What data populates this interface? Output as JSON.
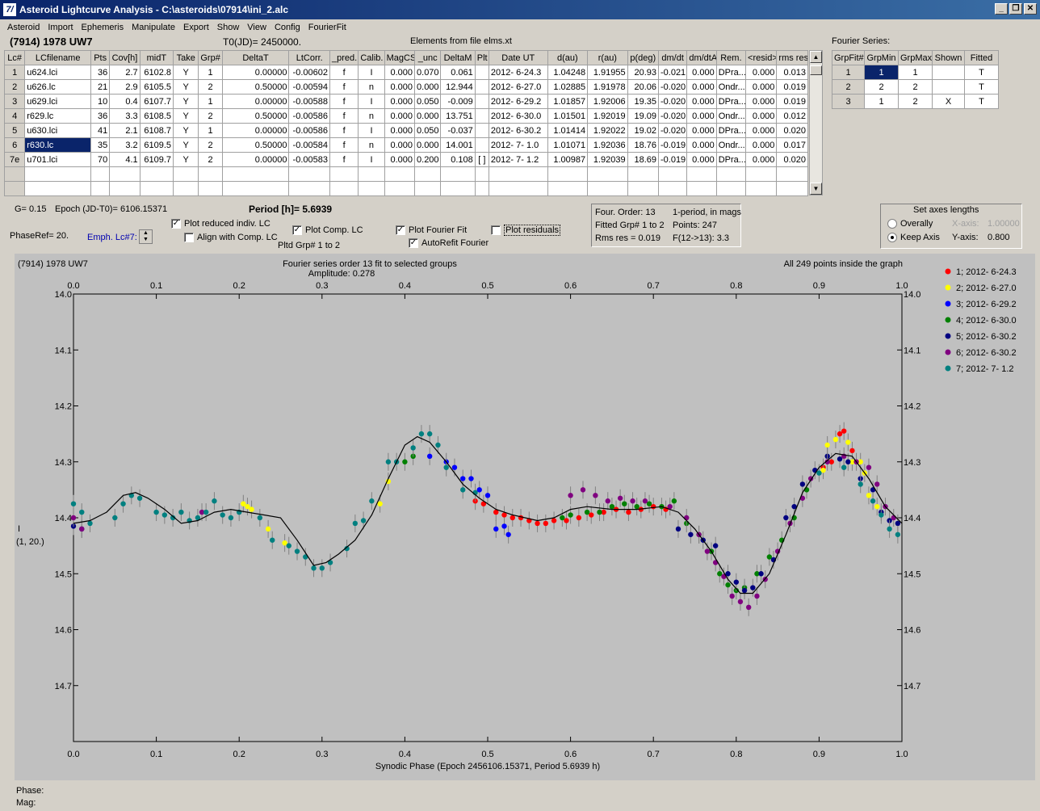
{
  "window": {
    "title": "Asteroid Lightcurve Analysis - C:\\asteroids\\07914\\ini_2.alc",
    "logo": "7/"
  },
  "menu": [
    "Asteroid",
    "Import",
    "Ephemeris",
    "Manipulate",
    "Export",
    "Show",
    "View",
    "Config",
    "FourierFit"
  ],
  "header": {
    "object": "(7914) 1978 UW7",
    "t0": "T0(JD)= 2450000.",
    "elements": "Elements from file elms.xt"
  },
  "lc_table": {
    "columns": [
      "Lc#",
      "LCfilename",
      "Pts",
      "Cov[h]",
      "midT",
      "Take",
      "Grp#",
      "DeltaT",
      "LtCorr.",
      "_pred.",
      "Calib.",
      "MagCS",
      "_unc",
      "DeltaM",
      "Plt",
      "Date UT",
      "d(au)",
      "r(au)",
      "p(deg)",
      "dm/dt",
      "dm/dtA",
      "Rem.",
      "<resid>",
      "rms res"
    ],
    "rows": [
      [
        "1",
        "u624.lci",
        "36",
        "2.7",
        "6102.8",
        "Y",
        "1",
        "0.00000",
        "-0.00602",
        "f",
        "I",
        "0.000",
        "0.070",
        "0.061",
        "",
        "2012- 6-24.3",
        "1.04248",
        "1.91955",
        "20.93",
        "-0.021",
        "0.000",
        "DPra...",
        "0.000",
        "0.013"
      ],
      [
        "2",
        "u626.lc",
        "21",
        "2.9",
        "6105.5",
        "Y",
        "2",
        "0.50000",
        "-0.00594",
        "f",
        "n",
        "0.000",
        "0.000",
        "12.944",
        "",
        "2012- 6-27.0",
        "1.02885",
        "1.91978",
        "20.06",
        "-0.020",
        "0.000",
        "Ondr...",
        "0.000",
        "0.019"
      ],
      [
        "3",
        "u629.lci",
        "10",
        "0.4",
        "6107.7",
        "Y",
        "1",
        "0.00000",
        "-0.00588",
        "f",
        "I",
        "0.000",
        "0.050",
        "-0.009",
        "",
        "2012- 6-29.2",
        "1.01857",
        "1.92006",
        "19.35",
        "-0.020",
        "0.000",
        "DPra...",
        "0.000",
        "0.019"
      ],
      [
        "4",
        "r629.lc",
        "36",
        "3.3",
        "6108.5",
        "Y",
        "2",
        "0.50000",
        "-0.00586",
        "f",
        "n",
        "0.000",
        "0.000",
        "13.751",
        "",
        "2012- 6-30.0",
        "1.01501",
        "1.92019",
        "19.09",
        "-0.020",
        "0.000",
        "Ondr...",
        "0.000",
        "0.012"
      ],
      [
        "5",
        "u630.lci",
        "41",
        "2.1",
        "6108.7",
        "Y",
        "1",
        "0.00000",
        "-0.00586",
        "f",
        "I",
        "0.000",
        "0.050",
        "-0.037",
        "",
        "2012- 6-30.2",
        "1.01414",
        "1.92022",
        "19.02",
        "-0.020",
        "0.000",
        "DPra...",
        "0.000",
        "0.020"
      ],
      [
        "6",
        "r630.lc",
        "35",
        "3.2",
        "6109.5",
        "Y",
        "2",
        "0.50000",
        "-0.00584",
        "f",
        "n",
        "0.000",
        "0.000",
        "14.001",
        "",
        "2012- 7- 1.0",
        "1.01071",
        "1.92036",
        "18.76",
        "-0.019",
        "0.000",
        "Ondr...",
        "0.000",
        "0.017"
      ],
      [
        "7e",
        "u701.lci",
        "70",
        "4.1",
        "6109.7",
        "Y",
        "2",
        "0.00000",
        "-0.00583",
        "f",
        "I",
        "0.000",
        "0.200",
        "0.108",
        "[ ]",
        "2012- 7- 1.2",
        "1.00987",
        "1.92039",
        "18.69",
        "-0.019",
        "0.000",
        "DPra...",
        "0.000",
        "0.020"
      ]
    ]
  },
  "fourier_series": {
    "title": "Fourier Series:",
    "columns": [
      "GrpFit#",
      "GrpMin",
      "GrpMax",
      "Shown",
      "Fitted"
    ],
    "rows": [
      [
        "1",
        "1",
        "1",
        "",
        "T"
      ],
      [
        "2",
        "2",
        "2",
        "",
        "T"
      ],
      [
        "3",
        "1",
        "2",
        "X",
        "T"
      ]
    ]
  },
  "controls": {
    "g": "G= 0.15",
    "epoch": "Epoch (JD-T0)= 6106.15371",
    "period": "Period [h]= 5.6939",
    "phaseref": "PhaseRef= 20.",
    "emph": "Emph. Lc#7:",
    "plot_reduced": "Plot reduced indiv. LC",
    "align": "Align with Comp. LC",
    "plot_comp": "Plot Comp. LC",
    "pltd_grp": "Pltd Grp#  1   to   2",
    "plot_fourier": "Plot Fourier Fit",
    "autorefit": "AutoRefit Fourier",
    "plot_resid": "Plot residuals"
  },
  "fitinfo": {
    "l1a": "Four. Order: 13",
    "l1b": "1-period, in mags",
    "l2a": "Fitted Grp# 1 to 2",
    "l2b": "Points: 247",
    "l3a": "Rms res     = 0.019",
    "l3b": "F(12->13):  3.3"
  },
  "axes_box": {
    "title": "Set axes lengths",
    "overally": "Overally",
    "keep": "Keep Axis",
    "xlab": "X-axis:",
    "xval": "1.00000",
    "ylab": "Y-axis:",
    "yval": "0.800"
  },
  "plot": {
    "top_left": "(7914) 1978 UW7",
    "title1": "Fourier series order 13 fit to selected groups",
    "title2": "Amplitude: 0.278",
    "top_right": "All 249 points inside the graph",
    "ylabel1": "I",
    "ylabel2": "(1, 20.)",
    "xlabel": "Synodic Phase (Epoch 2456106.15371, Period 5.6939 h)"
  },
  "status": {
    "phase": "Phase:",
    "mag": "Mag:"
  },
  "chart_data": {
    "type": "scatter",
    "x_ticks": [
      "0.0",
      "0.1",
      "0.2",
      "0.3",
      "0.4",
      "0.5",
      "0.6",
      "0.7",
      "0.8",
      "0.9",
      "1.0"
    ],
    "y_ticks": [
      "14.0",
      "14.1",
      "14.2",
      "14.3",
      "14.4",
      "14.5",
      "14.6",
      "14.7"
    ],
    "xlim": [
      0,
      1
    ],
    "ylim": [
      14.8,
      14.0
    ],
    "series": [
      {
        "name": "1; 2012- 6-24.3",
        "color": "#ff0000",
        "points": [
          [
            0.51,
            14.39
          ],
          [
            0.52,
            14.395
          ],
          [
            0.53,
            14.4
          ],
          [
            0.54,
            14.4
          ],
          [
            0.55,
            14.405
          ],
          [
            0.56,
            14.41
          ],
          [
            0.57,
            14.41
          ],
          [
            0.58,
            14.405
          ],
          [
            0.595,
            14.405
          ],
          [
            0.61,
            14.4
          ],
          [
            0.625,
            14.395
          ],
          [
            0.64,
            14.39
          ],
          [
            0.655,
            14.385
          ],
          [
            0.67,
            14.39
          ],
          [
            0.685,
            14.385
          ],
          [
            0.7,
            14.38
          ],
          [
            0.715,
            14.385
          ],
          [
            0.485,
            14.37
          ],
          [
            0.495,
            14.375
          ],
          [
            0.905,
            14.31
          ],
          [
            0.915,
            14.3
          ],
          [
            0.925,
            14.25
          ],
          [
            0.93,
            14.245
          ],
          [
            0.94,
            14.28
          ]
        ]
      },
      {
        "name": "2; 2012- 6-27.0",
        "color": "#ffff00",
        "points": [
          [
            0.205,
            14.375
          ],
          [
            0.21,
            14.38
          ],
          [
            0.215,
            14.385
          ],
          [
            0.235,
            14.42
          ],
          [
            0.255,
            14.445
          ],
          [
            0.38,
            14.335
          ],
          [
            0.37,
            14.375
          ],
          [
            0.905,
            14.315
          ],
          [
            0.91,
            14.27
          ],
          [
            0.92,
            14.26
          ],
          [
            0.935,
            14.265
          ],
          [
            0.955,
            14.32
          ],
          [
            0.96,
            14.36
          ],
          [
            0.95,
            14.3
          ],
          [
            0.97,
            14.38
          ],
          [
            0.94,
            14.3
          ]
        ]
      },
      {
        "name": "3; 2012- 6-29.2",
        "color": "#0000ff",
        "points": [
          [
            0.43,
            14.29
          ],
          [
            0.45,
            14.3
          ],
          [
            0.46,
            14.31
          ],
          [
            0.47,
            14.33
          ],
          [
            0.48,
            14.33
          ],
          [
            0.49,
            14.35
          ],
          [
            0.5,
            14.36
          ],
          [
            0.51,
            14.42
          ],
          [
            0.52,
            14.415
          ],
          [
            0.525,
            14.43
          ]
        ]
      },
      {
        "name": "4; 2012- 6-30.0",
        "color": "#008000",
        "points": [
          [
            0.4,
            14.3
          ],
          [
            0.41,
            14.29
          ],
          [
            0.59,
            14.4
          ],
          [
            0.6,
            14.395
          ],
          [
            0.62,
            14.39
          ],
          [
            0.635,
            14.39
          ],
          [
            0.65,
            14.38
          ],
          [
            0.665,
            14.375
          ],
          [
            0.68,
            14.38
          ],
          [
            0.695,
            14.375
          ],
          [
            0.71,
            14.38
          ],
          [
            0.725,
            14.37
          ],
          [
            0.74,
            14.41
          ],
          [
            0.755,
            14.43
          ],
          [
            0.77,
            14.46
          ],
          [
            0.78,
            14.5
          ],
          [
            0.79,
            14.52
          ],
          [
            0.8,
            14.53
          ],
          [
            0.81,
            14.525
          ],
          [
            0.825,
            14.5
          ],
          [
            0.84,
            14.47
          ],
          [
            0.855,
            14.44
          ],
          [
            0.87,
            14.4
          ],
          [
            0.885,
            14.35
          ]
        ]
      },
      {
        "name": "5; 2012- 6-30.2",
        "color": "#000080",
        "points": [
          [
            0.73,
            14.42
          ],
          [
            0.745,
            14.43
          ],
          [
            0.76,
            14.44
          ],
          [
            0.775,
            14.45
          ],
          [
            0.79,
            14.5
          ],
          [
            0.8,
            14.515
          ],
          [
            0.81,
            14.53
          ],
          [
            0.82,
            14.525
          ],
          [
            0.83,
            14.5
          ],
          [
            0.845,
            14.475
          ],
          [
            0.86,
            14.4
          ],
          [
            0.87,
            14.38
          ],
          [
            0.88,
            14.34
          ],
          [
            0.895,
            14.315
          ],
          [
            0.91,
            14.29
          ],
          [
            0.925,
            14.295
          ],
          [
            0.935,
            14.3
          ],
          [
            0.95,
            14.33
          ],
          [
            0.965,
            14.35
          ],
          [
            0.975,
            14.39
          ],
          [
            0.985,
            14.405
          ],
          [
            0.995,
            14.41
          ],
          [
            0.0,
            14.415
          ],
          [
            0.01,
            14.42
          ]
        ]
      },
      {
        "name": "6; 2012- 6-30.2",
        "color": "#800080",
        "points": [
          [
            0.0,
            14.4
          ],
          [
            0.01,
            14.42
          ],
          [
            0.155,
            14.39
          ],
          [
            0.6,
            14.36
          ],
          [
            0.615,
            14.35
          ],
          [
            0.63,
            14.36
          ],
          [
            0.645,
            14.37
          ],
          [
            0.66,
            14.365
          ],
          [
            0.675,
            14.37
          ],
          [
            0.69,
            14.37
          ],
          [
            0.72,
            14.38
          ],
          [
            0.74,
            14.4
          ],
          [
            0.755,
            14.43
          ],
          [
            0.765,
            14.46
          ],
          [
            0.775,
            14.48
          ],
          [
            0.785,
            14.505
          ],
          [
            0.795,
            14.54
          ],
          [
            0.805,
            14.55
          ],
          [
            0.815,
            14.56
          ],
          [
            0.825,
            14.54
          ],
          [
            0.835,
            14.51
          ],
          [
            0.85,
            14.46
          ],
          [
            0.865,
            14.41
          ],
          [
            0.88,
            14.365
          ],
          [
            0.89,
            14.33
          ],
          [
            0.91,
            14.3
          ],
          [
            0.93,
            14.29
          ],
          [
            0.945,
            14.3
          ],
          [
            0.96,
            14.31
          ],
          [
            0.97,
            14.34
          ],
          [
            0.98,
            14.38
          ],
          [
            0.99,
            14.4
          ]
        ]
      },
      {
        "name": "7; 2012- 7- 1.2",
        "color": "#008080",
        "points": [
          [
            0.0,
            14.375
          ],
          [
            0.01,
            14.39
          ],
          [
            0.02,
            14.41
          ],
          [
            0.05,
            14.4
          ],
          [
            0.06,
            14.375
          ],
          [
            0.07,
            14.36
          ],
          [
            0.08,
            14.365
          ],
          [
            0.1,
            14.39
          ],
          [
            0.11,
            14.395
          ],
          [
            0.12,
            14.4
          ],
          [
            0.13,
            14.39
          ],
          [
            0.14,
            14.405
          ],
          [
            0.15,
            14.4
          ],
          [
            0.16,
            14.39
          ],
          [
            0.17,
            14.37
          ],
          [
            0.18,
            14.395
          ],
          [
            0.19,
            14.4
          ],
          [
            0.2,
            14.39
          ],
          [
            0.225,
            14.4
          ],
          [
            0.24,
            14.44
          ],
          [
            0.26,
            14.45
          ],
          [
            0.27,
            14.46
          ],
          [
            0.28,
            14.47
          ],
          [
            0.29,
            14.49
          ],
          [
            0.3,
            14.49
          ],
          [
            0.31,
            14.48
          ],
          [
            0.33,
            14.455
          ],
          [
            0.34,
            14.41
          ],
          [
            0.35,
            14.405
          ],
          [
            0.36,
            14.37
          ],
          [
            0.38,
            14.3
          ],
          [
            0.39,
            14.3
          ],
          [
            0.41,
            14.275
          ],
          [
            0.42,
            14.25
          ],
          [
            0.43,
            14.25
          ],
          [
            0.44,
            14.27
          ],
          [
            0.45,
            14.31
          ],
          [
            0.47,
            14.35
          ],
          [
            0.485,
            14.355
          ],
          [
            0.9,
            14.32
          ],
          [
            0.93,
            14.31
          ],
          [
            0.95,
            14.34
          ],
          [
            0.965,
            14.37
          ],
          [
            0.975,
            14.395
          ],
          [
            0.985,
            14.42
          ],
          [
            0.995,
            14.43
          ]
        ]
      }
    ],
    "fit_points": [
      [
        0.0,
        14.41
      ],
      [
        0.02,
        14.405
      ],
      [
        0.04,
        14.39
      ],
      [
        0.06,
        14.36
      ],
      [
        0.075,
        14.355
      ],
      [
        0.09,
        14.365
      ],
      [
        0.11,
        14.385
      ],
      [
        0.13,
        14.41
      ],
      [
        0.15,
        14.405
      ],
      [
        0.17,
        14.39
      ],
      [
        0.19,
        14.385
      ],
      [
        0.21,
        14.39
      ],
      [
        0.23,
        14.395
      ],
      [
        0.25,
        14.4
      ],
      [
        0.27,
        14.44
      ],
      [
        0.29,
        14.485
      ],
      [
        0.305,
        14.48
      ],
      [
        0.32,
        14.465
      ],
      [
        0.34,
        14.44
      ],
      [
        0.36,
        14.395
      ],
      [
        0.38,
        14.33
      ],
      [
        0.4,
        14.27
      ],
      [
        0.415,
        14.255
      ],
      [
        0.43,
        14.265
      ],
      [
        0.45,
        14.3
      ],
      [
        0.47,
        14.34
      ],
      [
        0.49,
        14.365
      ],
      [
        0.51,
        14.385
      ],
      [
        0.53,
        14.395
      ],
      [
        0.56,
        14.405
      ],
      [
        0.58,
        14.4
      ],
      [
        0.6,
        14.385
      ],
      [
        0.62,
        14.38
      ],
      [
        0.65,
        14.385
      ],
      [
        0.68,
        14.385
      ],
      [
        0.71,
        14.38
      ],
      [
        0.73,
        14.39
      ],
      [
        0.75,
        14.42
      ],
      [
        0.77,
        14.46
      ],
      [
        0.79,
        14.51
      ],
      [
        0.805,
        14.535
      ],
      [
        0.82,
        14.535
      ],
      [
        0.84,
        14.5
      ],
      [
        0.86,
        14.43
      ],
      [
        0.88,
        14.355
      ],
      [
        0.9,
        14.31
      ],
      [
        0.92,
        14.285
      ],
      [
        0.94,
        14.29
      ],
      [
        0.96,
        14.33
      ],
      [
        0.98,
        14.38
      ],
      [
        1.0,
        14.41
      ]
    ]
  }
}
